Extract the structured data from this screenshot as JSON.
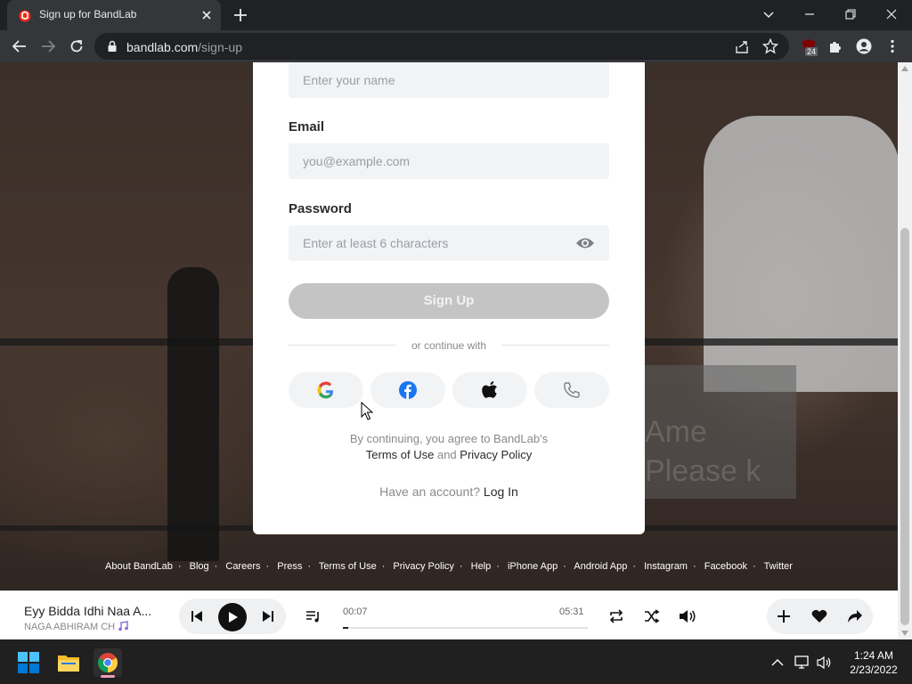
{
  "browser": {
    "tab_title": "Sign up for BandLab",
    "url_host": "bandlab.com",
    "url_path": "/sign-up",
    "extension_badge": "24"
  },
  "form": {
    "name_placeholder": "Enter your name",
    "email_label": "Email",
    "email_placeholder": "you@example.com",
    "password_label": "Password",
    "password_placeholder": "Enter at least 6 characters",
    "signup_label": "Sign Up",
    "continue_with": "or continue with",
    "terms_prefix": "By continuing, you agree to BandLab's",
    "terms_link": "Terms of Use",
    "terms_and": "and",
    "privacy_link": "Privacy Policy",
    "have_account": "Have an account?",
    "login_link": "Log In"
  },
  "background_sign": [
    "Ame",
    "Please k"
  ],
  "footer_links": [
    "About BandLab",
    "Blog",
    "Careers",
    "Press",
    "Terms of Use",
    "Privacy Policy",
    "Help",
    "iPhone App",
    "Android App",
    "Instagram",
    "Facebook",
    "Twitter"
  ],
  "player": {
    "track_title": "Eyy Bidda Idhi Naa A...",
    "artist": "NAGA ABHIRAM CH",
    "elapsed": "00:07",
    "duration": "05:31",
    "progress_fraction": 0.02
  },
  "taskbar": {
    "time": "1:24 AM",
    "date": "2/23/2022"
  },
  "colors": {
    "google_blue": "#4285F4",
    "facebook_blue": "#1877F2",
    "bandlab_red": "#F12C18"
  }
}
